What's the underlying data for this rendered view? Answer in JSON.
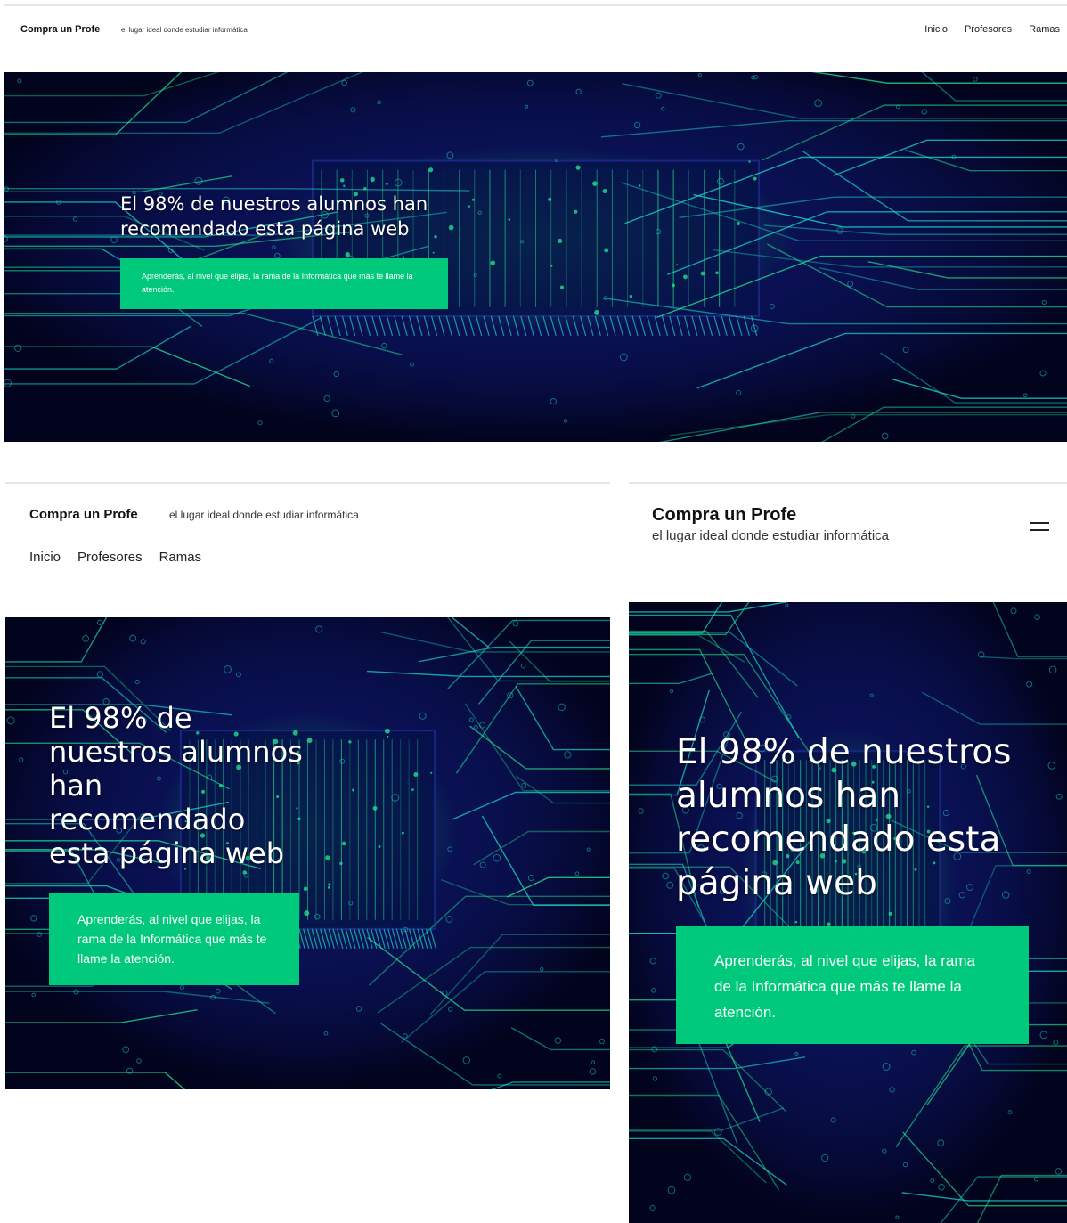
{
  "site": {
    "brand": "Compra un Profe",
    "tagline": "el lugar ideal donde estudiar informática",
    "nav": [
      "Inicio",
      "Profesores",
      "Ramas"
    ]
  },
  "hero": {
    "headline": "El 98% de nuestros alumnos han recomendado esta página web",
    "cta_text": "Aprenderás, al nivel que elijas, la rama de la Informática que más te llame la atención."
  },
  "icons": {
    "menu": "hamburger-menu-icon",
    "background": "circuit-board-image"
  },
  "colors": {
    "accent": "#00c97c",
    "hero_dark": "#02031c",
    "circuit_glow": "#1fe08f",
    "circuit_cyan": "#19d6c8",
    "circuit_blue": "#0f1a78"
  }
}
